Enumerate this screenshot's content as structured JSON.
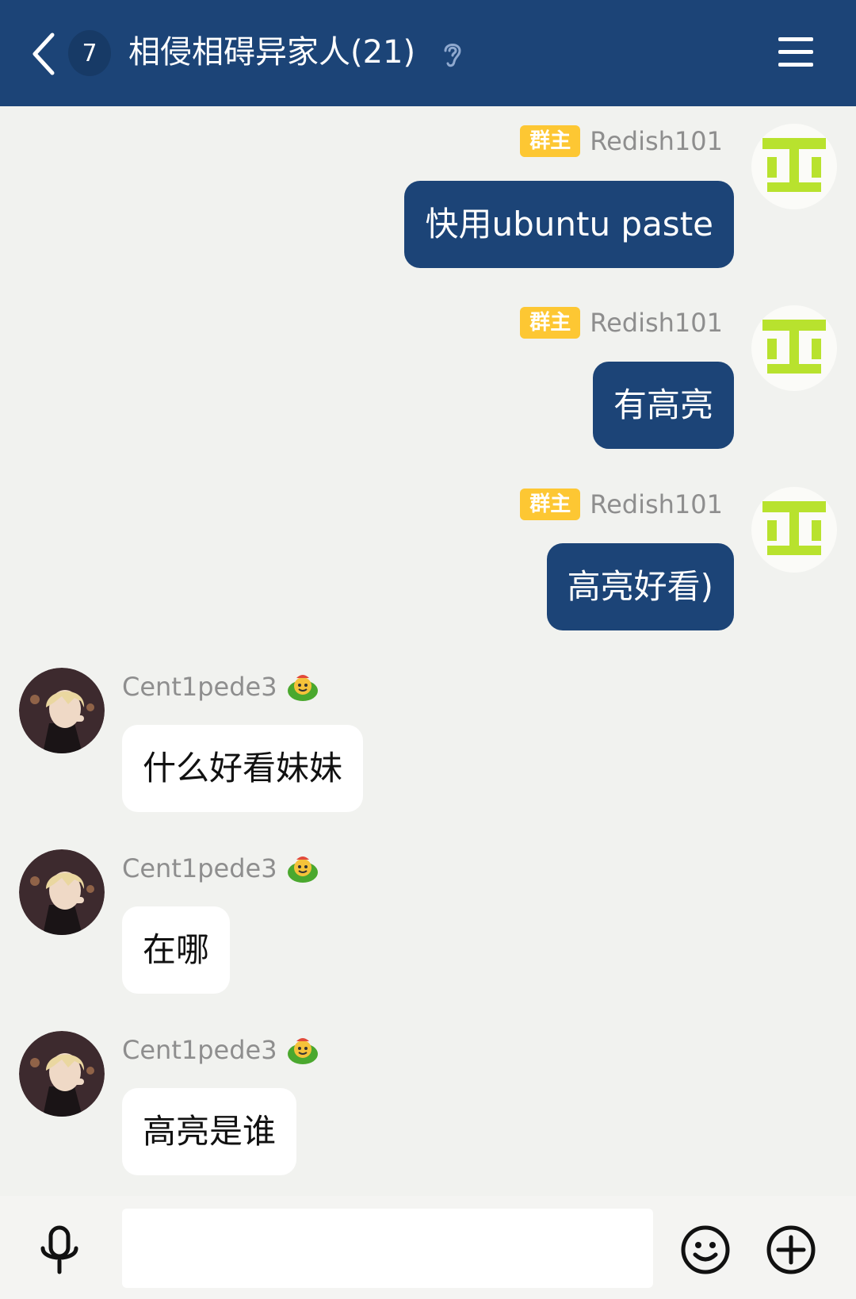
{
  "header": {
    "unread_count": "7",
    "title": "相侵相碍异家人(21)"
  },
  "messages": [
    {
      "side": "right",
      "role_badge": "群主",
      "sender": "Redish101",
      "text": "快用ubuntu paste"
    },
    {
      "side": "right",
      "role_badge": "群主",
      "sender": "Redish101",
      "text": "有高亮"
    },
    {
      "side": "right",
      "role_badge": "群主",
      "sender": "Redish101",
      "text": "高亮好看)"
    },
    {
      "side": "left",
      "sender": "Cent1pede3",
      "text": "什么好看妹妹"
    },
    {
      "side": "left",
      "sender": "Cent1pede3",
      "text": "在哪"
    },
    {
      "side": "left",
      "sender": "Cent1pede3",
      "text": "高亮是谁"
    }
  ],
  "input_bar": {
    "input_value": "",
    "placeholder": ""
  },
  "colors": {
    "header_bg": "#1c4477",
    "own_bubble": "#1c4477",
    "role_badge": "#fdc733",
    "avatar_accent": "#b8e22e"
  },
  "icons": [
    "back-arrow-icon",
    "ear-icon",
    "menu-icon",
    "frog-icon",
    "microphone-icon",
    "emoji-icon",
    "plus-icon"
  ]
}
